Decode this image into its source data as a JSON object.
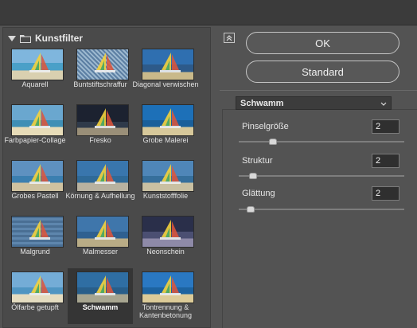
{
  "filter_panel": {
    "category": "Kunstfilter",
    "filters": [
      {
        "label": "Aquarell",
        "thumb": "a"
      },
      {
        "label": "Buntstiftschraffur",
        "thumb": "b"
      },
      {
        "label": "Diagonal verwischen",
        "thumb": "c"
      },
      {
        "label": "Farbpapier-Collage",
        "thumb": "d"
      },
      {
        "label": "Fresko",
        "thumb": "e"
      },
      {
        "label": "Grobe Malerei",
        "thumb": "f"
      },
      {
        "label": "Grobes Pastell",
        "thumb": "g"
      },
      {
        "label": "Körnung & Aufhellung",
        "thumb": "h"
      },
      {
        "label": "Kunststofffolie",
        "thumb": "i"
      },
      {
        "label": "Malgrund",
        "thumb": "j"
      },
      {
        "label": "Malmesser",
        "thumb": "k"
      },
      {
        "label": "Neonschein",
        "thumb": "l"
      },
      {
        "label": "Ölfarbe getupft",
        "thumb": "m"
      },
      {
        "label": "Schwamm",
        "thumb": "n"
      },
      {
        "label": "Tontrennung & Kantenbetonung",
        "thumb": "o"
      }
    ],
    "selected": "Schwamm"
  },
  "buttons": {
    "ok": "OK",
    "standard": "Standard"
  },
  "filter_select": {
    "value": "Schwamm"
  },
  "params": [
    {
      "label": "Pinselgröße",
      "value": "2",
      "level": 0.2
    },
    {
      "label": "Struktur",
      "value": "2",
      "level": 0.083
    },
    {
      "label": "Glättung",
      "value": "2",
      "level": 0.067
    }
  ],
  "icons": {
    "collapse": "collapse-icon",
    "folder": "folder-icon",
    "disclosure": "triangle-down-icon",
    "dropdown": "chevron-down-icon"
  }
}
